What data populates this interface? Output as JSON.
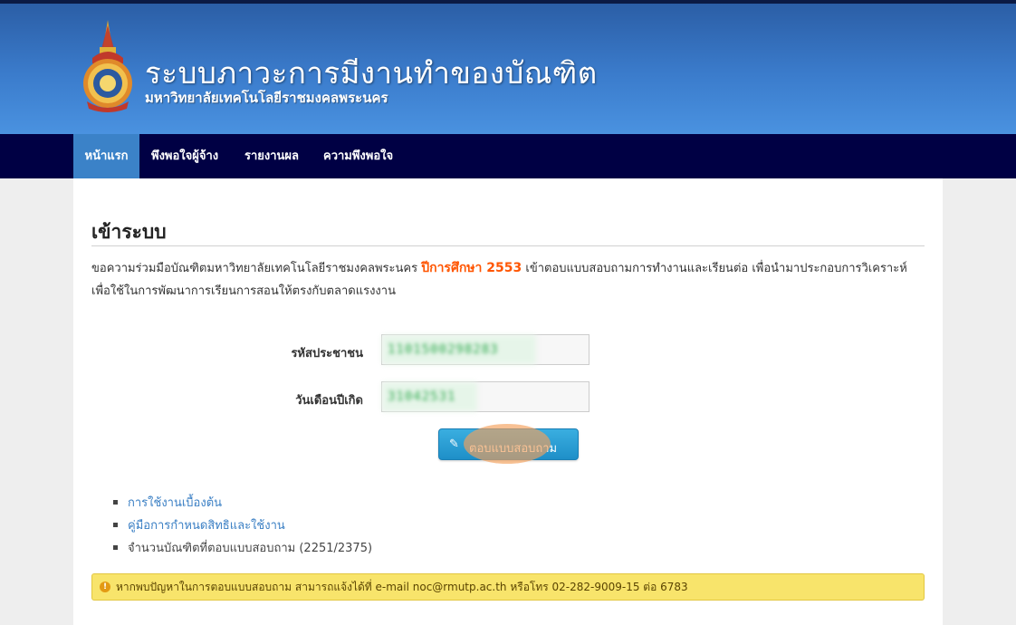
{
  "header": {
    "title": "ระบบภาวะการมีงานทำของบัณฑิต",
    "subtitle": "มหาวิทยาลัยเทคโนโลยีราชมงคลพระนคร"
  },
  "nav": {
    "items": [
      {
        "label": "หน้าแรก",
        "active": true
      },
      {
        "label": "พึงพอใจผู้จ้าง",
        "active": false
      },
      {
        "label": "รายงานผล",
        "active": false
      },
      {
        "label": "ความพึงพอใจ",
        "active": false
      }
    ]
  },
  "main": {
    "title": "เข้าระบบ",
    "intro_before": "ขอความร่วมมือบัณฑิตมหาวิทยาลัยเทคโนโลยีราชมงคลพระนคร ",
    "intro_highlight": "ปีการศึกษา 2553",
    "intro_after": " เข้าตอบแบบสอบถามการทำงานและเรียนต่อ เพื่อนำมาประกอบการวิเคราะห์ เพื่อใช้ในการพัฒนาการเรียนการสอนให้ตรงกับตลาดแรงงาน"
  },
  "form": {
    "id_label": "รหัสประชาชน",
    "id_value": "1101500298283",
    "dob_label": "วันเดือนปีเกิด",
    "dob_value": "31042531",
    "submit_label": "ตอบแบบสอบถาม"
  },
  "links": {
    "basic_usage": "การใช้งานเบื้องต้น",
    "permission_manual": "คู่มือการกำหนดสิทธิและใช้งาน",
    "respondent_count": "จำนวนบัณฑิตที่ตอบแบบสอบถาม (2251/2375)"
  },
  "alert": {
    "text": "หากพบปัญหาในการตอบแบบสอบถาม สามารถแจ้งได้ที่ e-mail noc@rmutp.ac.th หรือโทร 02-282-9009-15 ต่อ 6783"
  },
  "colors": {
    "header_top": "#2b5ea6",
    "header_bottom": "#4a92e0",
    "navbar": "#000044",
    "nav_active": "#3b82c8",
    "highlight": "#ff5500",
    "link": "#3a7fc4",
    "alert_bg": "#f8e46b",
    "button": "#1e8fc8"
  },
  "icons": {
    "logo": "university-emblem",
    "button": "pencil-icon",
    "alert": "info-circle-icon"
  }
}
